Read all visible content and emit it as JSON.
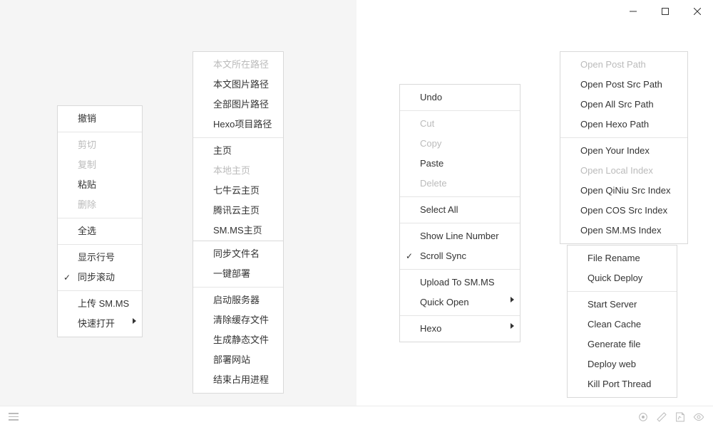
{
  "menu_cn_edit": {
    "undo": "撤销",
    "cut": "剪切",
    "copy": "复制",
    "paste": "粘贴",
    "delete": "删除",
    "select_all": "全选",
    "show_line_number": "显示行号",
    "scroll_sync": "同步滚动",
    "upload_smms": "上传 SM.MS",
    "quick_open": "快速打开"
  },
  "menu_cn_paths": {
    "post_path": "本文所在路径",
    "post_src_path": "本文图片路径",
    "all_src_path": "全部图片路径",
    "hexo_path": "Hexo项目路径",
    "your_index": "主页",
    "local_index": "本地主页",
    "qiniu_index": "七牛云主页",
    "cos_index": "腾讯云主页",
    "smms_index": "SM.MS主页"
  },
  "menu_cn_deploy": {
    "file_rename": "同步文件名",
    "quick_deploy": "一键部署",
    "start_server": "启动服务器",
    "clean_cache": "清除缓存文件",
    "generate_file": "生成静态文件",
    "deploy_web": "部署网站",
    "kill_port": "结束占用进程"
  },
  "menu_en_edit": {
    "undo": "Undo",
    "cut": "Cut",
    "copy": "Copy",
    "paste": "Paste",
    "delete": "Delete",
    "select_all": "Select All",
    "show_line_number": "Show Line Number",
    "scroll_sync": "Scroll Sync",
    "upload_smms": "Upload To SM.MS",
    "quick_open": "Quick Open",
    "hexo": "Hexo"
  },
  "menu_en_paths": {
    "post_path": "Open Post Path",
    "post_src_path": "Open Post Src Path",
    "all_src_path": "Open All Src Path",
    "hexo_path": "Open Hexo Path",
    "your_index": "Open Your Index",
    "local_index": "Open Local Index",
    "qiniu_index": "Open QiNiu Src Index",
    "cos_index": "Open COS Src Index",
    "smms_index": "Open SM.MS Index"
  },
  "menu_en_deploy": {
    "file_rename": "File Rename",
    "quick_deploy": "Quick Deploy",
    "start_server": "Start Server",
    "clean_cache": "Clean Cache",
    "generate_file": "Generate file",
    "deploy_web": "Deploy web",
    "kill_port": "Kill Port Thread"
  }
}
